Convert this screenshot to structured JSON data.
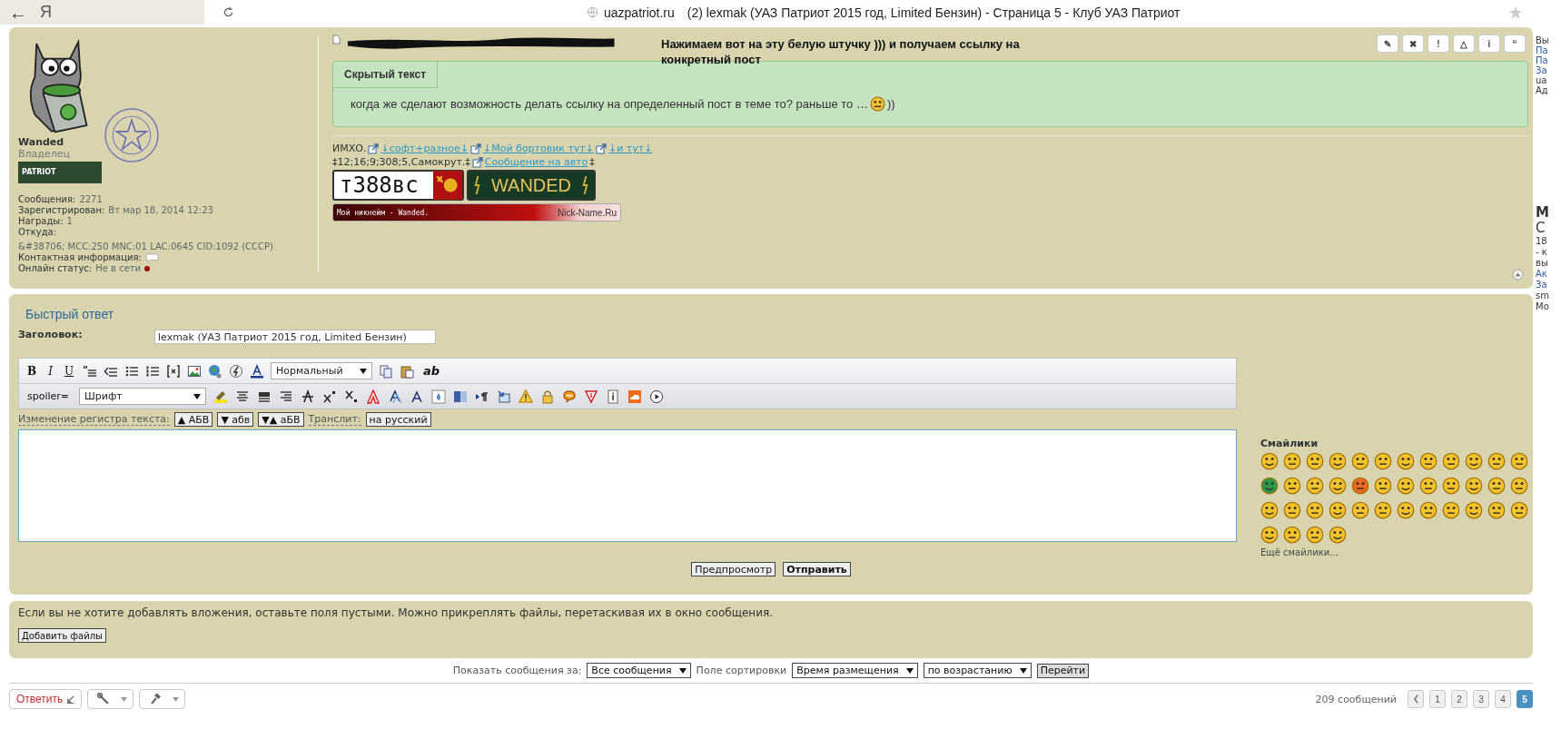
{
  "browser": {
    "back": "←",
    "logo": "Я",
    "url": "uazpatriot.ru",
    "title": "(2) lexmak (УАЗ Патриот 2015 год, Limited Бензин) - Страница 5 - Клуб УАЗ Патриот"
  },
  "post": {
    "author": "Wanded",
    "rank": "Владелец",
    "rank_badge": "PATRIOT",
    "profile": [
      {
        "label": "Сообщения:",
        "value": "2271"
      },
      {
        "label": "Зарегистрирован:",
        "value": "Вт мар 18, 2014 12:23"
      },
      {
        "label": "Награды:",
        "value": "1"
      },
      {
        "label": "Откуда:",
        "value": "&#38706; MCC:250 MNC:01 LAC:0645 CID:1092 (СССР)"
      },
      {
        "label": "Контактная информация:",
        "kind": "contact"
      },
      {
        "label": "Онлайн статус:",
        "value": "Не в сети",
        "kind": "status",
        "online": false
      }
    ],
    "annotation": "Нажимаем вот на эту белую штучку ))) и получаем ссылку на конкретный пост",
    "actions": [
      "✎",
      "✖",
      "!",
      "△",
      "i",
      "‘‘"
    ],
    "spoiler": {
      "title": "Скрытый текст",
      "text": "когда же сделают возможность делать ссылку на определенный пост в теме то? раньше то …",
      "after": "))"
    },
    "signature": {
      "prefix": "ИМХО.",
      "links": [
        "↓софт+разное↓",
        "↓Мой бортовик тут↓",
        "↓и тут↓"
      ],
      "line2": "‡12;16;9;308;5,Самокрут.‡",
      "line2_link": "Сообщение на авто",
      "line2_end": "‡",
      "plate": "т388вс",
      "plate2": "WANDED",
      "nick_text": "Мой никнейм - Wanded.",
      "nick_site": "Nick-Name.Ru"
    }
  },
  "reply": {
    "title": "Быстрый ответ",
    "subject_label": "Заголовок:",
    "subject": "lexmak (УАЗ Патриот 2015 год, Limited Бензин)",
    "format_buttons": [
      "B",
      "I",
      "U"
    ],
    "style_select": "Нормальный",
    "ab_button": "ab",
    "spoiler_button": "spoiler=",
    "font_select": "Шрифт",
    "case_label": "Изменение регистра текста:",
    "case_buttons": [
      "▲ АБВ",
      "▼ абв",
      "▼▲ аБВ"
    ],
    "translit_label": "Транслит:",
    "translit_button": "на русский",
    "smileys_title": "Смайлики",
    "more_smileys": "Ещё смайлики...",
    "buttons": [
      "Предпросмотр",
      "Отправить"
    ]
  },
  "attach": {
    "text": "Если вы не хотите добавлять вложения, оставьте поля пустыми. Можно прикреплять файлы, перетаскивая их в окно сообщения.",
    "button": "Добавить файлы"
  },
  "sort": {
    "show_label": "Показать сообщения за:",
    "show": "Все сообщения",
    "field_label": "Поле сортировки",
    "field": "Время размещения",
    "order": "по возрастанию",
    "go": "Перейти"
  },
  "footer": {
    "reply": "Ответить",
    "count": "209 сообщений",
    "pages": [
      {
        "label": "1",
        "selected": false
      },
      {
        "label": "2",
        "selected": false
      },
      {
        "label": "3",
        "selected": false
      },
      {
        "label": "4",
        "selected": false
      },
      {
        "label": "5",
        "selected": true
      }
    ]
  },
  "right_edge": [
    "Вы",
    "Па",
    "Па",
    "За",
    "ua",
    "Ад"
  ],
  "right_edge_2": [
    "М",
    "С",
    "18",
    "- к",
    "вы",
    "Ак",
    "За",
    "sm",
    "Мо"
  ]
}
